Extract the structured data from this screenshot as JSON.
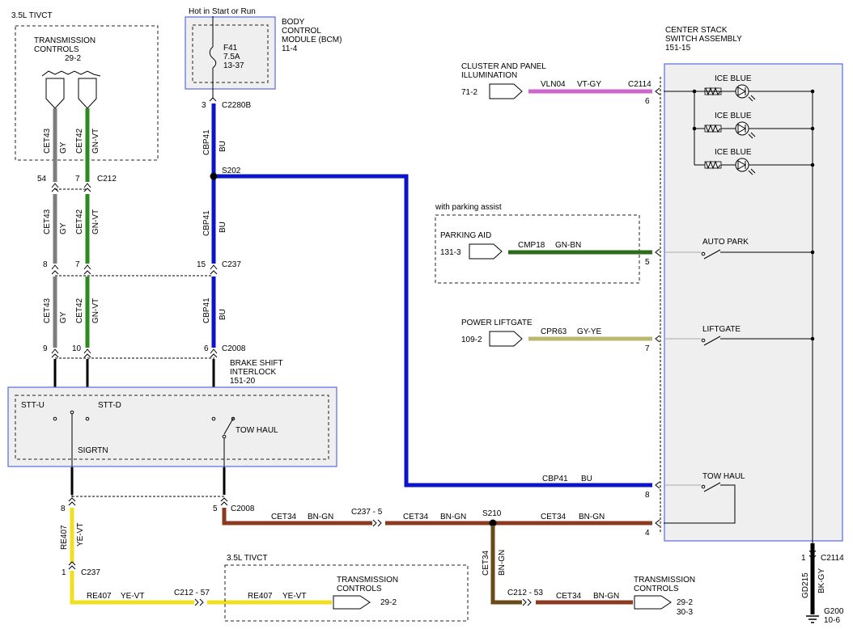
{
  "tivct_top": {
    "title": "3.5L TIVCT",
    "comp_name": "TRANSMISSION CONTROLS",
    "comp_name_l1": "TRANSMISSION",
    "comp_name_l2": "CONTROLS",
    "comp_ref": "29-2"
  },
  "hot_label": "Hot in Start or Run",
  "bcm": {
    "l1": "BODY",
    "l2": "CONTROL",
    "l3": "MODULE (BCM)",
    "ref": "11-4",
    "fuse": "F41",
    "amp": "7.5A",
    "fuse_ref": "13-37"
  },
  "conn": {
    "c2280b": "C2280B",
    "c2280b_pin": "3",
    "c212": "C212",
    "c212_p1": "54",
    "c212_p2": "7",
    "c237": "C237",
    "c237_p1": "8",
    "c237_p2": "7",
    "c237_p3": "15",
    "c2008": "C2008",
    "c2008_p1": "9",
    "c2008_p2": "10",
    "c2008_p3": "6",
    "c2008b": "C2008",
    "c2008b_pin": "5",
    "c237b": "C237",
    "c237b_pin": "1",
    "c237b_top_pin": "8",
    "c2114": "C2114",
    "c2114_pin": "6",
    "c2114b": "C2114",
    "c2114b_pin": "1",
    "pin5": "5",
    "pin7": "7",
    "pin8": "8",
    "pin4": "4"
  },
  "wires": {
    "cet43": "CET43",
    "gy": "GY",
    "cet42": "CET42",
    "gnvt": "GN-VT",
    "cbp41": "CBP41",
    "bu": "BU",
    "vln04": "VLN04",
    "vtgy": "VT-GY",
    "cmp18": "CMP18",
    "gnbn": "GN-BN",
    "cpr63": "CPR63",
    "gyye": "GY-YE",
    "cet34": "CET34",
    "bngn": "BN-GN",
    "re407": "RE407",
    "yevt": "YE-VT",
    "gd215": "GD215",
    "bkgy": "BK-GY"
  },
  "splices": {
    "s202": "S202",
    "s210": "S210"
  },
  "inline": {
    "c237_5": "C237  -  5",
    "c212_57": "C212  -  57",
    "c212_53": "C212  -  53"
  },
  "bsi": {
    "l1": "BRAKE SHIFT",
    "l2": "INTERLOCK",
    "ref": "151-20",
    "sttu": "STT-U",
    "sttd": "STT-D",
    "tow": "TOW HAUL",
    "sigrtn": "SIGRTN"
  },
  "csa": {
    "l1": "CENTER STACK",
    "l2": "SWITCH ASSEMBLY",
    "ref": "151-15",
    "ice1": "ICE BLUE",
    "ice2": "ICE BLUE",
    "ice3": "ICE BLUE",
    "autopark": "AUTO PARK",
    "liftgate": "LIFTGATE",
    "towhaul": "TOW HAUL"
  },
  "cluster": {
    "l1": "CLUSTER AND PANEL",
    "l2": "ILLUMINATION",
    "ref": "71-2"
  },
  "parking": {
    "note": "with parking assist",
    "name": "PARKING AID",
    "ref": "131-3"
  },
  "liftgate_src": {
    "name": "POWER LIFTGATE",
    "ref": "109-2"
  },
  "tivct_bottom": {
    "title": "3.5L TIVCT",
    "l1": "TRANSMISSION",
    "l2": "CONTROLS",
    "ref": "29-2"
  },
  "tc_right": {
    "l1": "TRANSMISSION",
    "l2": "CONTROLS",
    "ref1": "29-2",
    "ref2": "30-3"
  },
  "ground": {
    "name": "G200",
    "ref": "10-6"
  },
  "colors": {
    "gray": "#7d7d7d",
    "green": "#2e8b22",
    "blue": "#0a14c8",
    "violet": "#cc66cc",
    "brown": "#8b3a20",
    "yellow": "#f0e020",
    "olive": "#b8b870",
    "frame_blue": "#5a6ae0"
  }
}
